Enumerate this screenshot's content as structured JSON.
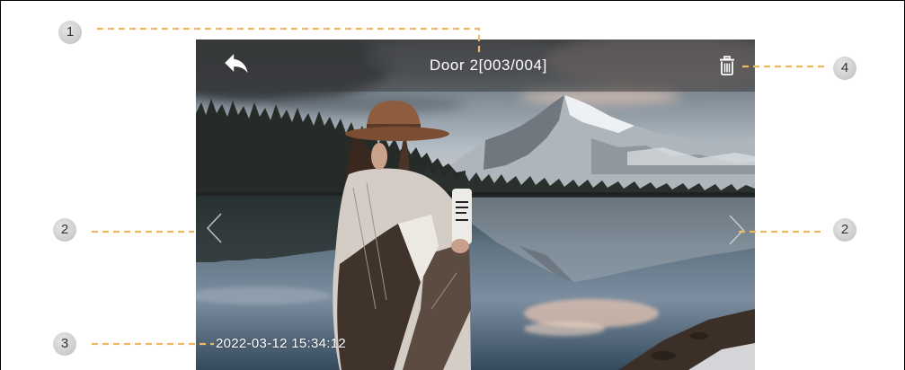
{
  "screen": {
    "title": "Door 2[003/004]",
    "timestamp": "2022-03-12 15:34:12"
  },
  "callouts": [
    "1",
    "2",
    "2",
    "3",
    "4"
  ],
  "icons": {
    "back": "back-arrow-icon",
    "delete": "trash-icon",
    "previous": "chevron-left-icon",
    "next": "chevron-right-icon"
  },
  "colors": {
    "callout_line": "#ecb86a",
    "callout_badge": "#cdcdcd",
    "callout_number": "#333333",
    "top_bar": "#3c3c3c",
    "overlay_text": "#ffffff"
  }
}
